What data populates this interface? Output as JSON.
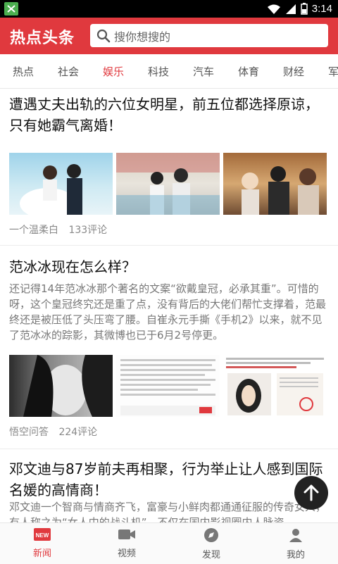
{
  "status": {
    "time": "3:14"
  },
  "header": {
    "title": "热点头条",
    "search_placeholder": "搜你想搜的"
  },
  "tabs": [
    "热点",
    "社会",
    "娱乐",
    "科技",
    "汽车",
    "体育",
    "财经",
    "军"
  ],
  "active_tab": "娱乐",
  "articles": [
    {
      "title": "遭遇丈夫出轨的六位女明星，前五位都选择原谅，只有她霸气离婚！",
      "source": "一个温柔白",
      "comments": "133评论"
    },
    {
      "title": "范冰冰现在怎么样？",
      "summary": "还记得14年范冰冰那个著名的文案“欲戴皇冠，必承其重”。可惜的呀，这个皇冠终究还是重了点，没有背后的大佬们帮忙支撑着，范最终还是被压低了头压弯了腰。自崔永元手撕《手机2》以来，就不见了范冰冰的踪影，其微博也已于6月2号停更。",
      "source": "悟空问答",
      "comments": "224评论"
    },
    {
      "title": "邓文迪与87岁前夫再相聚，行为举止让人感到国际名媛的高情商！",
      "summary": "邓文迪一个智商与情商齐飞，富豪与小鲜肉都通通征服的传奇女人，有人称之为“女人中的战斗机”，不仅在国内影视圈内人脉资"
    }
  ],
  "bottom_nav": [
    {
      "label": "新闻",
      "icon": "news-icon",
      "badge": "NEW"
    },
    {
      "label": "视频",
      "icon": "video-icon"
    },
    {
      "label": "发现",
      "icon": "discover-icon"
    },
    {
      "label": "我的",
      "icon": "profile-icon"
    }
  ],
  "colors": {
    "accent": "#e0393e"
  }
}
